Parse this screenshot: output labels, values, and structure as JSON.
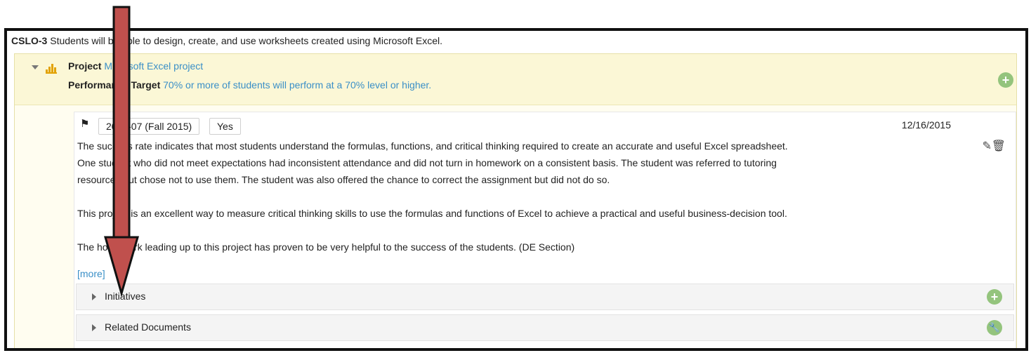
{
  "cslo": {
    "code": "CSLO-3",
    "statement": "Students will be able to design, create, and use worksheets created using Microsoft Excel."
  },
  "project": {
    "label": "Project",
    "value": "Microsoft Excel project",
    "performance_label": "Performance Target",
    "performance_value": "70% or more of students will perform at a 70% level or higher."
  },
  "result": {
    "term": "2015-07 (Fall 2015)",
    "met": "Yes",
    "date": "12/16/2015",
    "paragraphs": [
      "The success rate indicates that most students understand the formulas, functions, and critical thinking required to create an accurate and useful Excel spreadsheet.",
      "One student who did not meet expectations had inconsistent attendance and did not turn in homework on a consistent basis.  The student was referred to tutoring",
      "resources but chose not to use them.  The student was also offered the chance to correct the assignment but did not do so.",
      "This project is an excellent way to measure critical thinking skills to use the formulas and functions of Excel to achieve a practical and useful business-decision tool.",
      "The homework leading up to this project has proven to be very helpful to the success of the students.  (DE Section)"
    ],
    "more_link": "[more]"
  },
  "sections": {
    "initiatives": "Initiatives",
    "related_documents": "Related Documents"
  },
  "icons": {
    "plus": "+",
    "edit": "✎",
    "trash": "🗑",
    "flag": "⚑",
    "wrench": "🔧"
  },
  "colors": {
    "accent_link": "#3a8fc7",
    "add_button": "#94c47d",
    "arrow": "#c0504d"
  }
}
